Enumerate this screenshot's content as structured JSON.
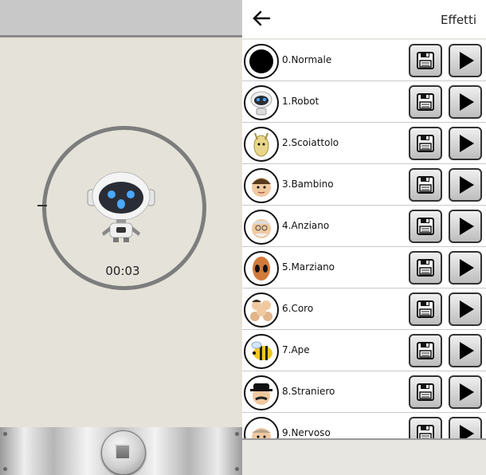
{
  "recorder": {
    "timer": "00:03",
    "effect_icon": "robot-icon"
  },
  "header": {
    "title": "Effetti",
    "back_icon": "back-arrow-icon"
  },
  "effects": [
    {
      "label": "0.Normale",
      "icon": "normal-dot"
    },
    {
      "label": "1.Robot",
      "icon": "robot"
    },
    {
      "label": "2.Scoiattolo",
      "icon": "squirrel"
    },
    {
      "label": "3.Bambino",
      "icon": "child"
    },
    {
      "label": "4.Anziano",
      "icon": "old-man"
    },
    {
      "label": "5.Marziano",
      "icon": "alien"
    },
    {
      "label": "6.Coro",
      "icon": "choir"
    },
    {
      "label": "7.Ape",
      "icon": "bee"
    },
    {
      "label": "8.Straniero",
      "icon": "foreigner"
    },
    {
      "label": "9.Nervoso",
      "icon": "nervous"
    }
  ],
  "colors": {
    "left_bg": "#e5e2d9",
    "ring": "#7d7d7d",
    "header_bg": "#ffffff"
  }
}
